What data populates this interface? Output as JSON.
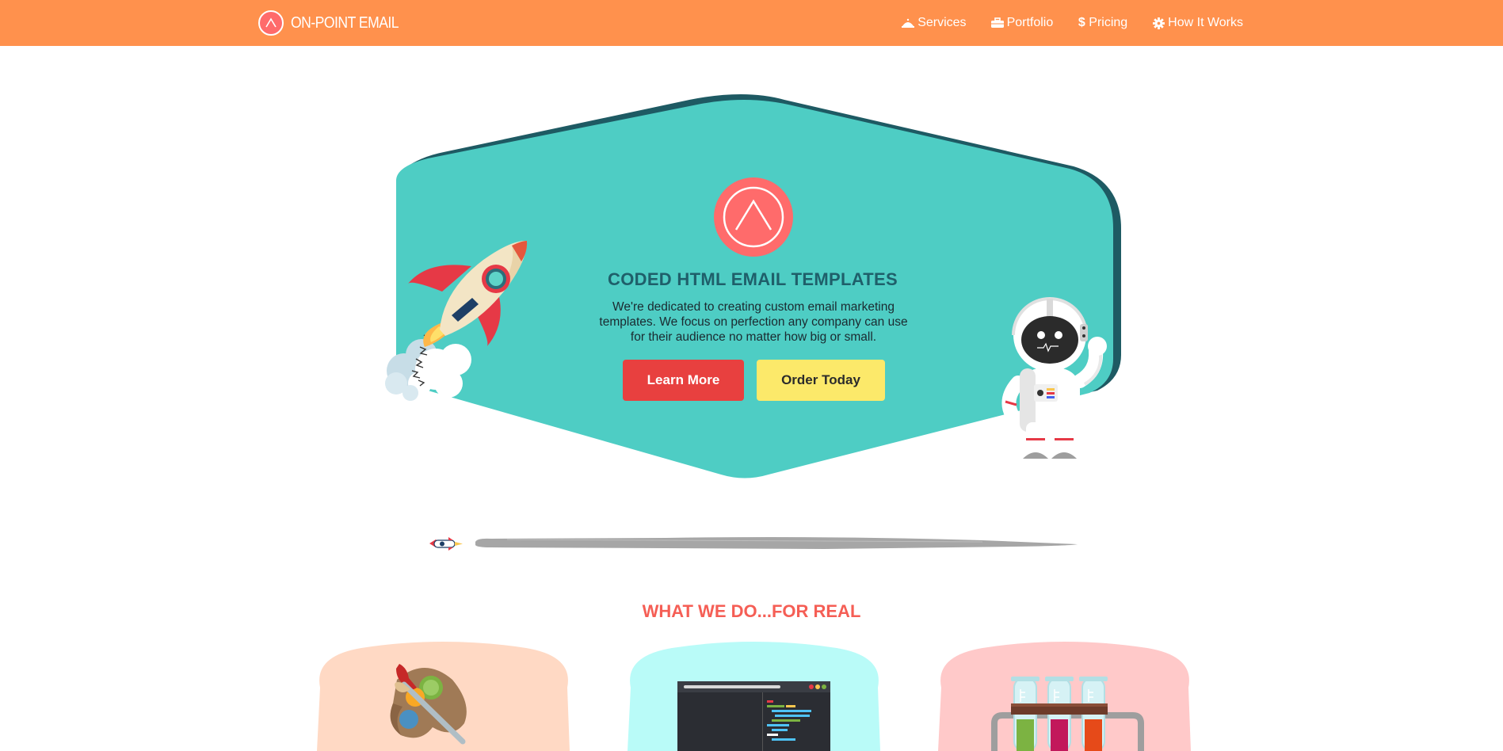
{
  "brand": {
    "name": "ON-POINT EMAIL",
    "logo_icon": "caret-up-circle-icon",
    "color": "#ff914d"
  },
  "nav": {
    "items": [
      {
        "label": "Services",
        "icon": "cake-icon"
      },
      {
        "label": "Portfolio",
        "icon": "briefcase-icon"
      },
      {
        "label": "Pricing",
        "icon": "dollar-icon"
      },
      {
        "label": "How It Works",
        "icon": "gear-icon"
      }
    ]
  },
  "hero": {
    "title": "CODED HTML EMAIL TEMPLATES",
    "description": "We're dedicated to creating custom email marketing templates. We focus on perfection any company can use for their audience no matter how big or small.",
    "learn_more_label": "Learn More",
    "order_today_label": "Order Today",
    "background_color": "#4ecdc4",
    "accent_color": "#1e5a63"
  },
  "section": {
    "title": "WHAT WE DO...FOR REAL",
    "cards": [
      {
        "icon": "paint-palette-icon",
        "color": "#ffd9c4"
      },
      {
        "icon": "code-editor-icon",
        "color": "#b9fbf8"
      },
      {
        "icon": "test-tubes-icon",
        "color": "#ffc9c9"
      }
    ]
  }
}
